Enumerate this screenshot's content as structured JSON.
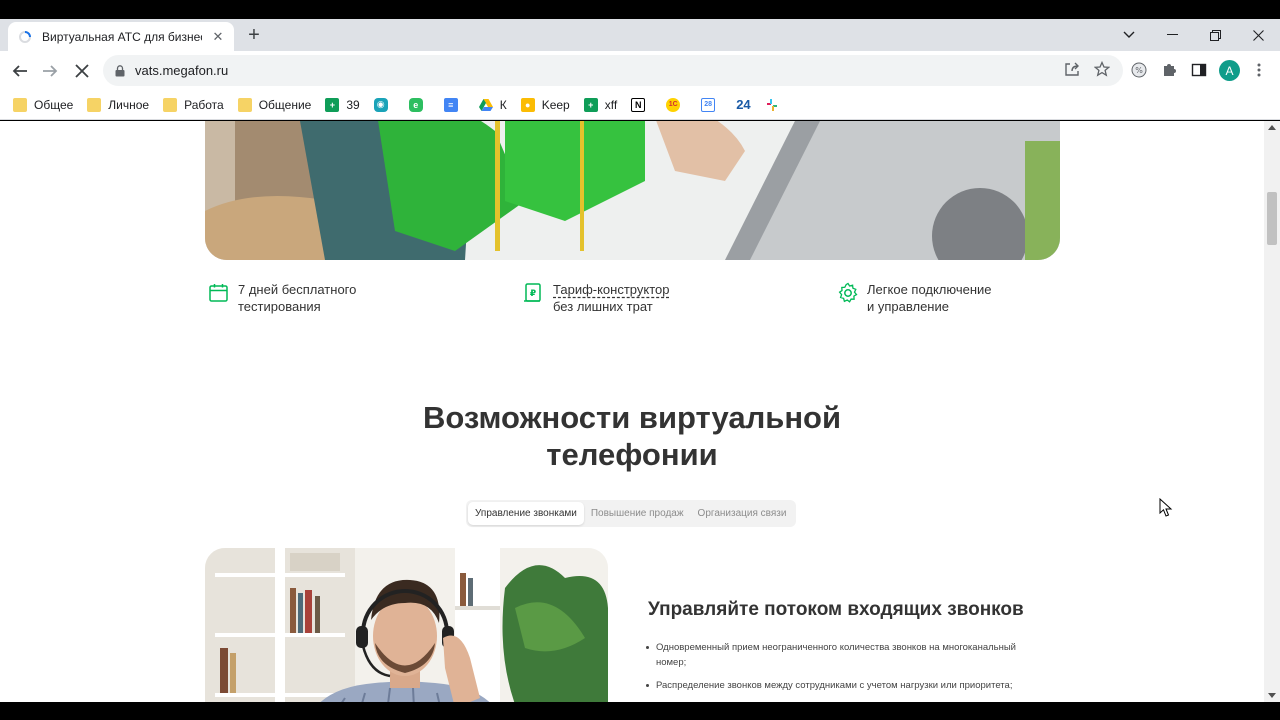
{
  "browser": {
    "tab_title": "Виртуальная АТС для бизнеса с",
    "url": "vats.megafon.ru",
    "avatar_letter": "A",
    "bookmarks": [
      {
        "label": "Общее",
        "icon": "folder-icon"
      },
      {
        "label": "Личное",
        "icon": "folder-icon"
      },
      {
        "label": "Работа",
        "icon": "folder-icon"
      },
      {
        "label": "Общение",
        "icon": "folder-icon"
      },
      {
        "label": "39",
        "icon": "sheets-icon"
      },
      {
        "label": "",
        "icon": "meet-icon"
      },
      {
        "label": "",
        "icon": "evernote-icon"
      },
      {
        "label": "",
        "icon": "docs-icon"
      },
      {
        "label": "К",
        "icon": "drive-icon"
      },
      {
        "label": "Keep",
        "icon": "keep-icon"
      },
      {
        "label": "xff",
        "icon": "sheets-icon"
      },
      {
        "label": "",
        "icon": "notion-icon"
      },
      {
        "label": "",
        "icon": "1c-icon"
      },
      {
        "label": "",
        "icon": "calendar-icon"
      },
      {
        "label": "24",
        "icon": "bitrix24-icon"
      },
      {
        "label": "",
        "icon": "slack-icon"
      }
    ]
  },
  "page": {
    "features": [
      {
        "line1": "7 дней бесплатного",
        "line2": "тестирования",
        "icon": "calendar-icon"
      },
      {
        "line1": "Тариф-конструктор",
        "line2": "без лишних трат",
        "icon": "document-icon"
      },
      {
        "line1": "Легкое подключение",
        "line2": "и управление",
        "icon": "gear-icon"
      }
    ],
    "section_title_line1": "Возможности виртуальной",
    "section_title_line2": "телефонии",
    "tabs": [
      {
        "label": "Управление звонками",
        "active": true
      },
      {
        "label": "Повышение продаж",
        "active": false
      },
      {
        "label": "Организация связи",
        "active": false
      }
    ],
    "content_title": "Управляйте потоком входящих звонков",
    "bullets": [
      "Одновременный прием неограниченного количества звонков на многоканальный номер;",
      "Распределение звонков между сотрудниками с учетом нагрузки или приоритета;"
    ]
  },
  "colors": {
    "accent_green": "#00b956",
    "text_dark": "#333333"
  }
}
